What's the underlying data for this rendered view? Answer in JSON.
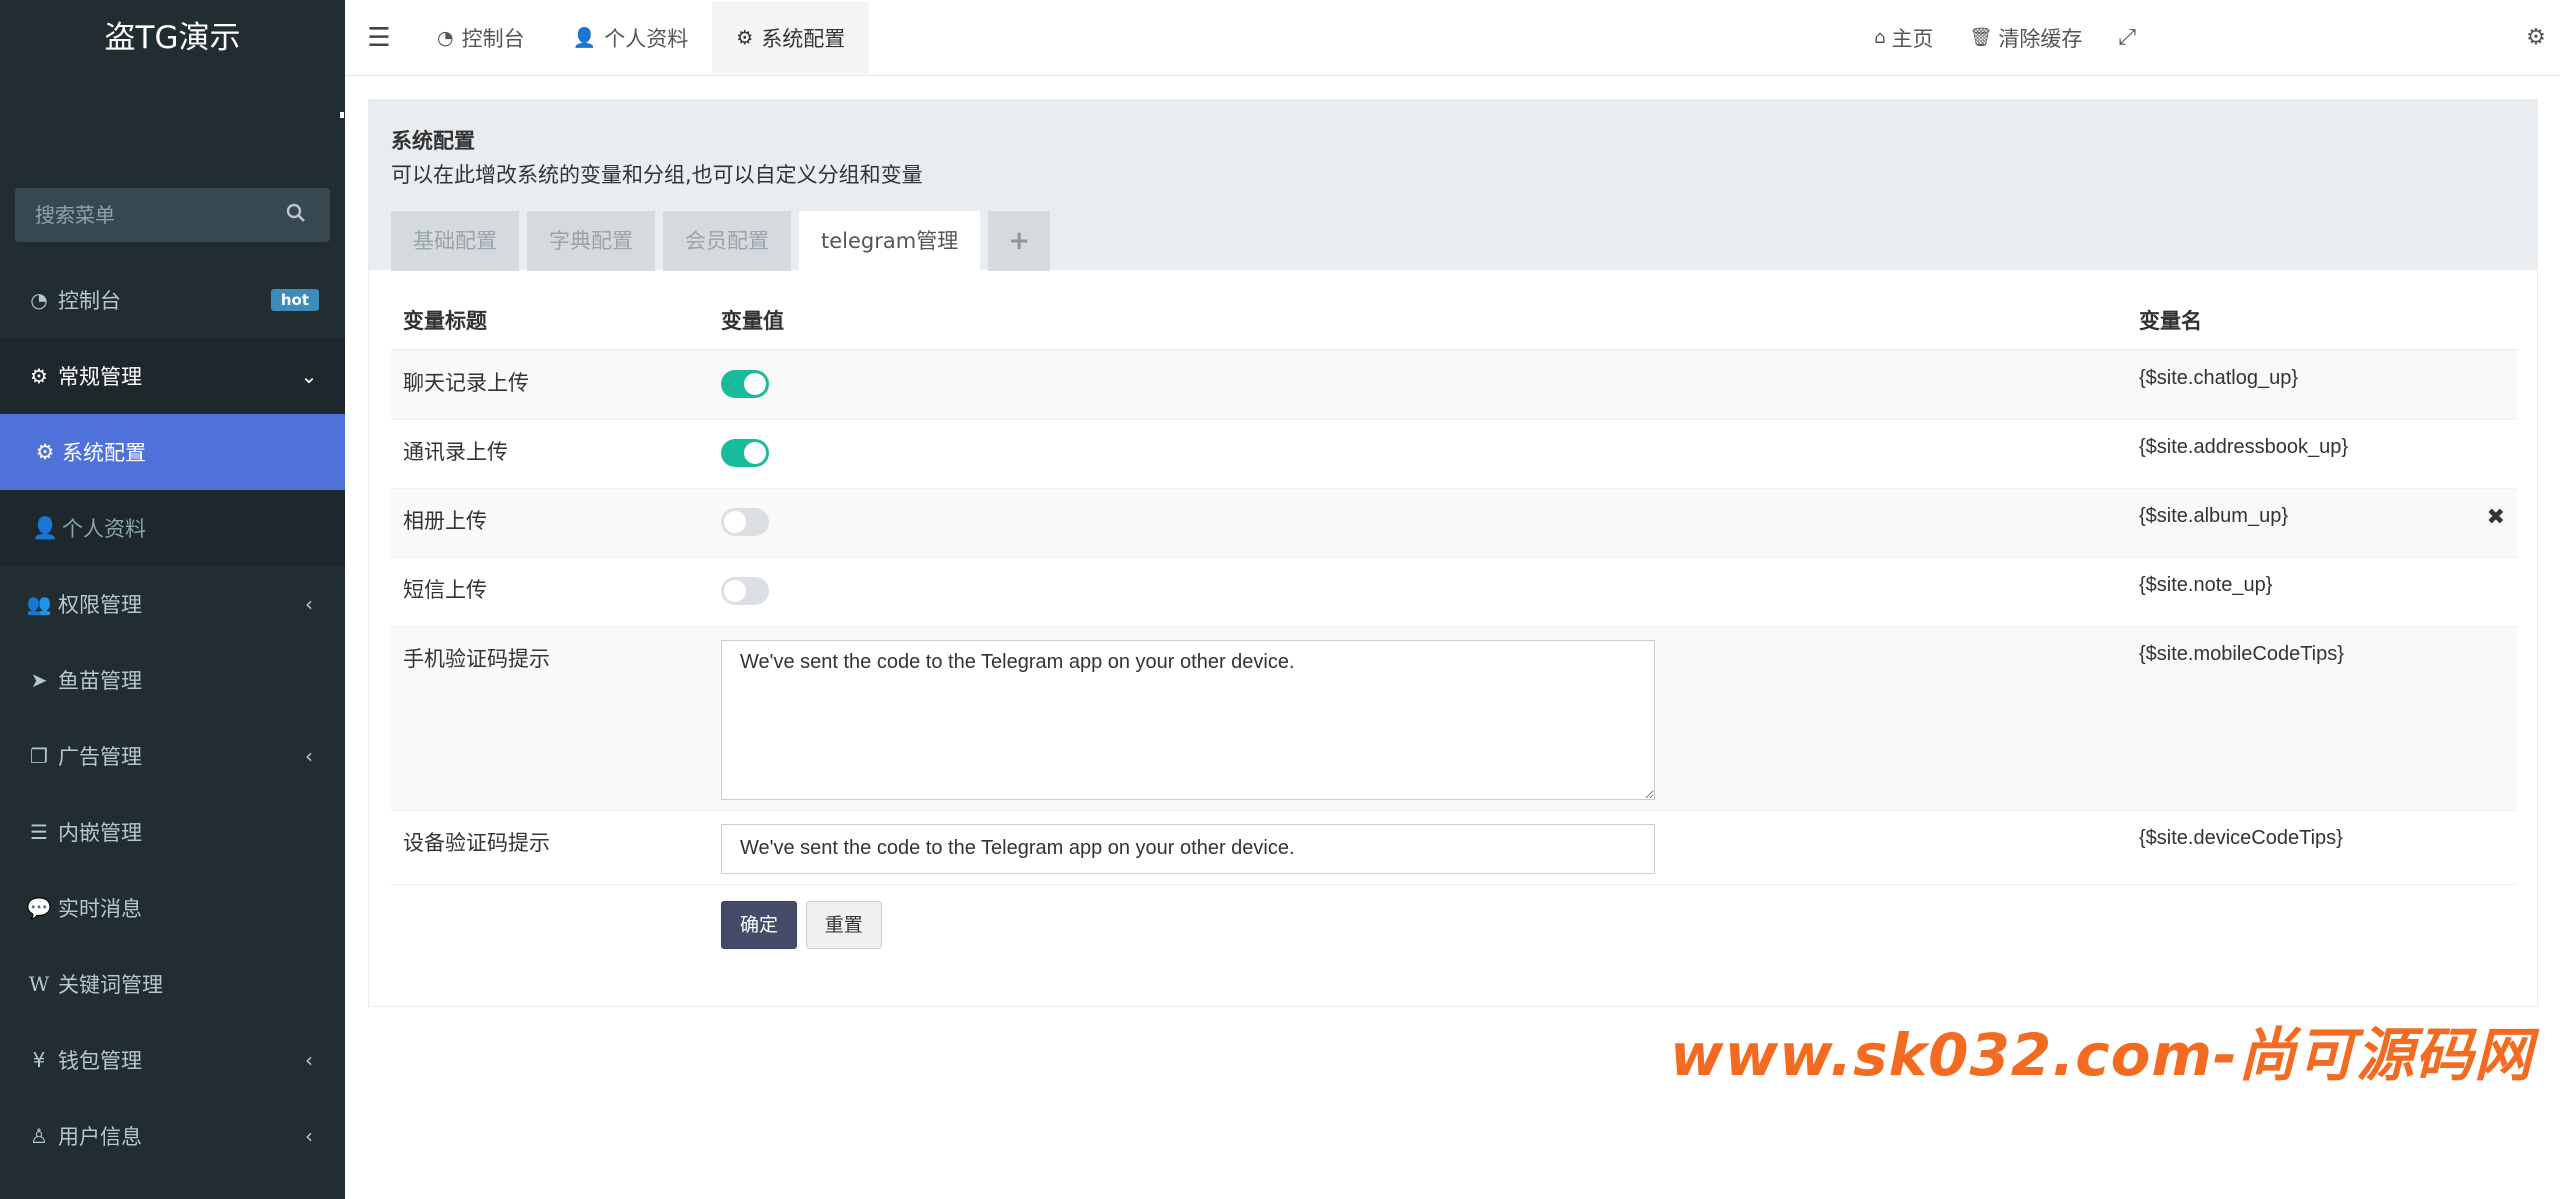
{
  "app": {
    "title": "盗TG演示"
  },
  "search": {
    "placeholder": "搜索菜单"
  },
  "sidebar": {
    "items": [
      {
        "label": "控制台",
        "icon": "dashboard-icon",
        "badge": "hot"
      },
      {
        "label": "常规管理",
        "icon": "cogs-icon",
        "open": true,
        "children": [
          {
            "label": "系统配置",
            "icon": "gear-icon",
            "active": true
          },
          {
            "label": "个人资料",
            "icon": "user-icon"
          }
        ]
      },
      {
        "label": "权限管理",
        "icon": "users-icon",
        "collapsible": true
      },
      {
        "label": "鱼苗管理",
        "icon": "telegram-icon"
      },
      {
        "label": "广告管理",
        "icon": "clone-icon",
        "collapsible": true
      },
      {
        "label": "内嵌管理",
        "icon": "list-icon"
      },
      {
        "label": "实时消息",
        "icon": "comments-icon"
      },
      {
        "label": "关键词管理",
        "icon": "wikipedia-icon"
      },
      {
        "label": "钱包管理",
        "icon": "yen-icon",
        "collapsible": true
      },
      {
        "label": "用户信息",
        "icon": "user-outline-icon",
        "collapsible": true
      }
    ]
  },
  "topbar": {
    "tabs": [
      {
        "label": "控制台",
        "icon": "dashboard-icon"
      },
      {
        "label": "个人资料",
        "icon": "user-icon"
      },
      {
        "label": "系统配置",
        "icon": "gear-icon",
        "active": true
      }
    ],
    "home": "主页",
    "clear_cache": "清除缓存"
  },
  "panel": {
    "title": "系统配置",
    "description": "可以在此增改系统的变量和分组,也可以自定义分组和变量",
    "tabs": [
      {
        "label": "基础配置"
      },
      {
        "label": "字典配置"
      },
      {
        "label": "会员配置"
      },
      {
        "label": "telegram管理",
        "active": true
      }
    ],
    "add_tab": "+"
  },
  "table": {
    "headers": {
      "title": "变量标题",
      "value": "变量值",
      "name": "变量名"
    },
    "rows": [
      {
        "title": "聊天记录上传",
        "type": "toggle",
        "on": true,
        "name": "{$site.chatlog_up}"
      },
      {
        "title": "通讯录上传",
        "type": "toggle",
        "on": true,
        "name": "{$site.addressbook_up}"
      },
      {
        "title": "相册上传",
        "type": "toggle",
        "on": false,
        "name": "{$site.album_up}"
      },
      {
        "title": "短信上传",
        "type": "toggle",
        "on": false,
        "name": "{$site.note_up}"
      },
      {
        "title": "手机验证码提示",
        "type": "textarea",
        "value": "We've sent the code to the Telegram app on your other device.",
        "name": "{$site.mobileCodeTips}"
      },
      {
        "title": "设备验证码提示",
        "type": "text",
        "value": "We've sent the code to the Telegram app on your other device.",
        "name": "{$site.deviceCodeTips}"
      }
    ],
    "submit": "确定",
    "reset": "重置"
  },
  "watermark": "www.sk032.com-尚可源码网",
  "colors": {
    "sidebar": "#222d32",
    "active": "#4e72d9",
    "toggle_on": "#18bc9c",
    "primary_btn": "#444c69",
    "watermark": "#f36b21"
  }
}
